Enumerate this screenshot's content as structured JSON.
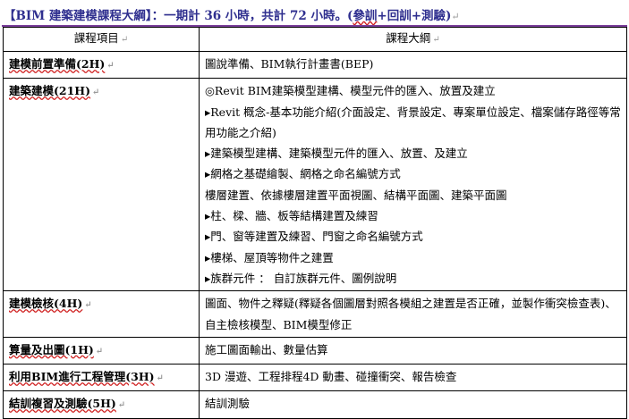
{
  "title": {
    "main": "【BIM 建築建模課程大綱】：一期計 36 小時，共計 72 小時。(",
    "underlined": "參訓",
    "rest": "+回訓+測驗)",
    "return_mark": "↵"
  },
  "table": {
    "headers": {
      "item": "課程項目",
      "outline": "課程大綱"
    },
    "rows": [
      {
        "item": "建模前置準備(2H)",
        "lines": [
          "圖說準備、BIM執行計畫書(BEP)"
        ]
      },
      {
        "item": "建築建模(21H)",
        "lines": [
          "◎Revit BIM建築模型建構、模型元件的匯入、放置及建立",
          "▸Revit 概念-基本功能介紹(介面設定、背景設定、專案單位設定、檔案儲存路徑等常用功能之介紹)",
          "▸建築模型建構、建築模型元件的匯入、放置、及建立",
          "▸網格之基礎繪製、網格之命名編號方式",
          "樓層建置、依據樓層建置平面視圖、結構平面圖、建築平面圖",
          "▸柱、樑、牆、板等結構建置及練習",
          "▸門、窗等建置及練習、門窗之命名編號方式",
          "▸樓梯、屋頂等物件之建置",
          "▸族群元件 ： 自訂族群元件、圖例說明"
        ]
      },
      {
        "item": "建模檢核(4H)",
        "lines": [
          "圖面、物件之釋疑(釋疑各個圖層對照各模組之建置是否正確，並製作衝突檢查表)、自主檢核模型、BIM模型修正"
        ]
      },
      {
        "item": "算量及出圖(1H)",
        "lines": [
          "施工圖面輸出、數量估算"
        ]
      },
      {
        "item": "利用BIM進行工程管理(3H)",
        "lines": [
          "3D 漫遊、工程排程4D 動畫、碰撞衝突、報告檢查"
        ]
      },
      {
        "item": "結訓複習及測驗(5H)",
        "lines": [
          "結訓測驗"
        ]
      }
    ]
  }
}
